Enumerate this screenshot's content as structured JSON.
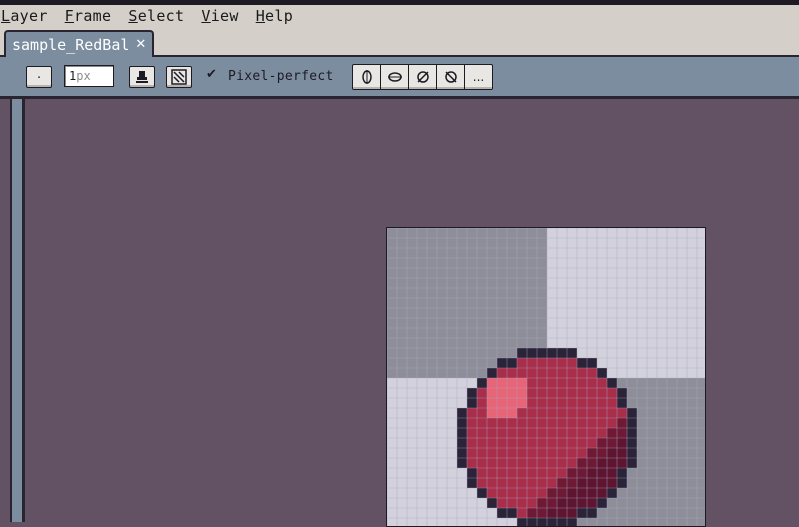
{
  "menubar": {
    "items": [
      {
        "first": "L",
        "rest": "ayer"
      },
      {
        "first": "F",
        "rest": "rame"
      },
      {
        "first": "S",
        "rest": "elect"
      },
      {
        "first": "V",
        "rest": "iew"
      },
      {
        "first": "H",
        "rest": "elp"
      }
    ]
  },
  "tab": {
    "title": "sample_RedBal",
    "close": "✕"
  },
  "toolbar": {
    "brush_shape_label": "·",
    "brush_size_value": "1",
    "brush_size_placeholder": "px",
    "pixel_perfect_checked": true,
    "pixel_perfect_check": "✔",
    "pixel_perfect_label": "Pixel-perfect",
    "more_label": "..."
  },
  "sprite": {
    "name": "RedBall",
    "colors": {
      "bg_dark": "#8e8e98",
      "bg_light": "#d3d2dc",
      "grid": "#a8a7c4",
      "outline": "#2b2337",
      "ball": "#a82e4a",
      "ball_shadow": "#5e1530",
      "highlight": "#e76577",
      "dark_red": "#6e1a34"
    }
  },
  "colors": {
    "workspace": "#635263",
    "toolbar": "#7d8da0",
    "menubar": "#d4cfc9"
  }
}
